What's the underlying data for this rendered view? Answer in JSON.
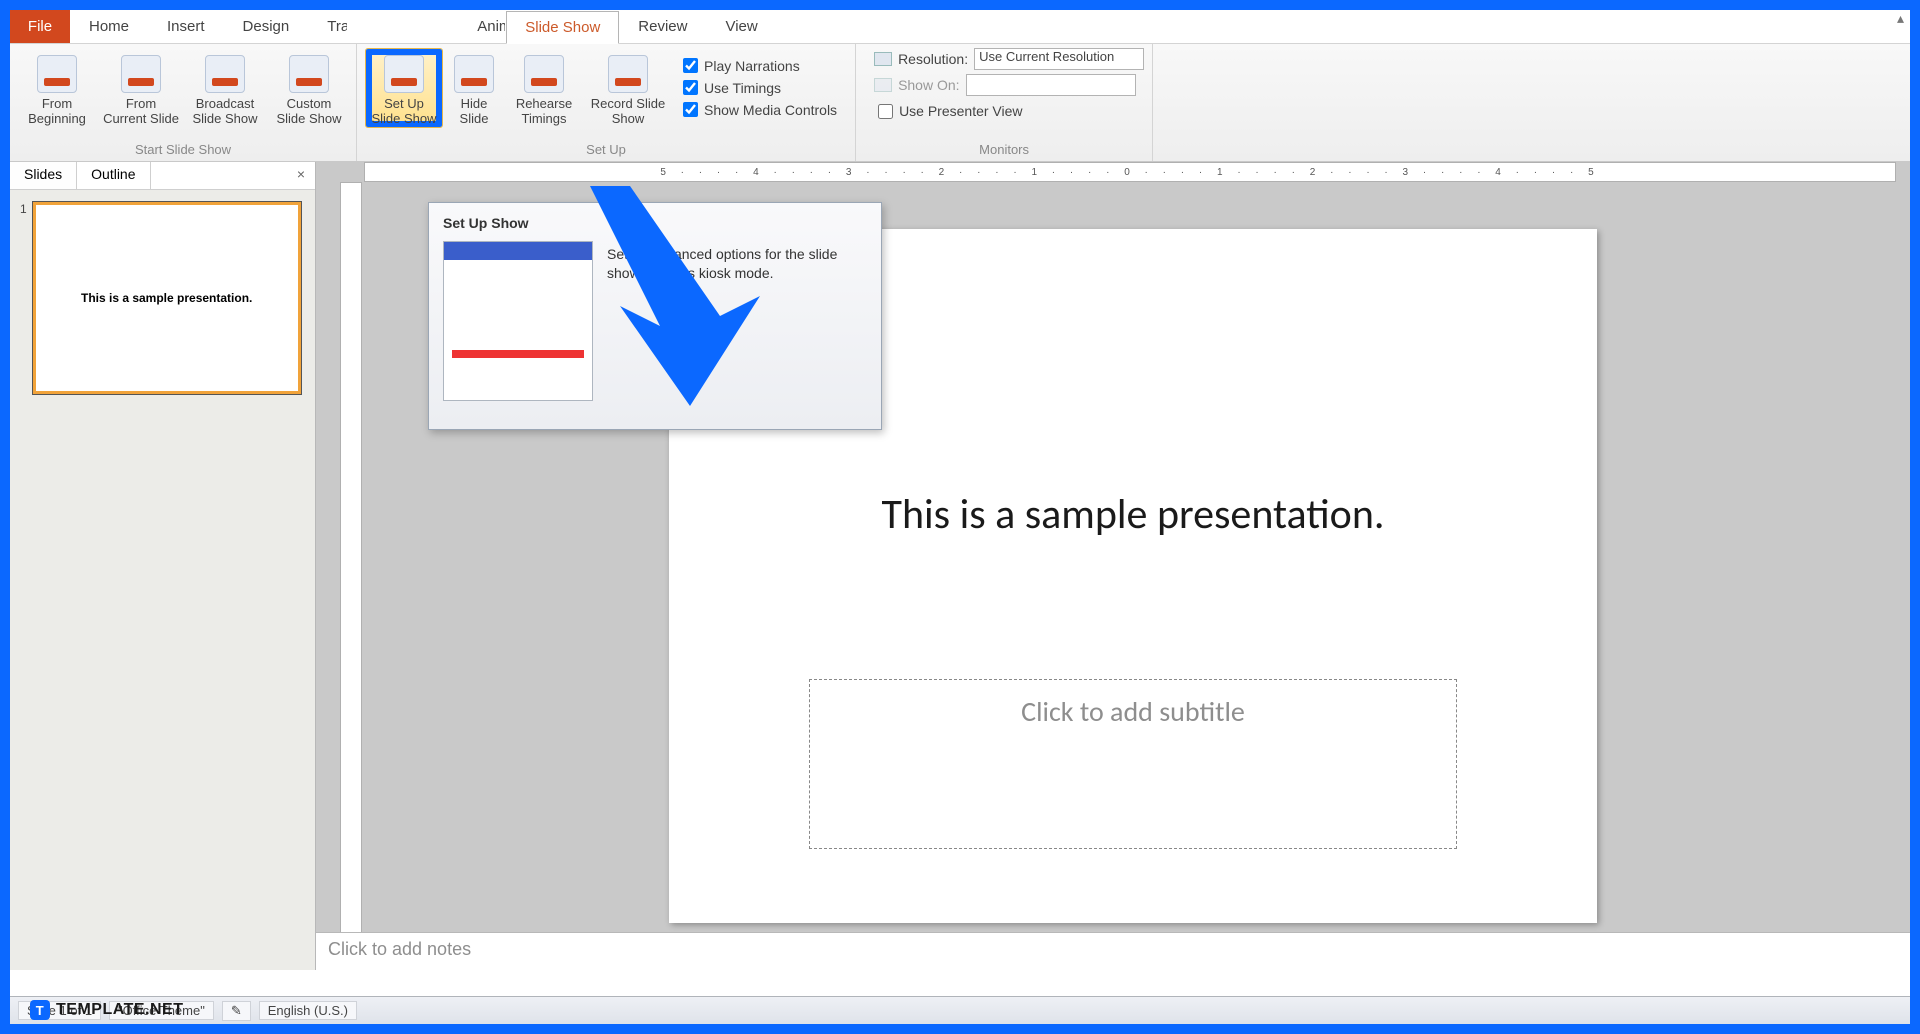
{
  "tabs": {
    "file": "File",
    "home": "Home",
    "insert": "Insert",
    "design": "Design",
    "transitions": "Transitions",
    "animations": "Animations",
    "slideShow": "Slide Show",
    "review": "Review",
    "view": "View"
  },
  "ribbon": {
    "start": {
      "fromBeginning": "From\nBeginning",
      "fromCurrent": "From\nCurrent Slide",
      "broadcast": "Broadcast\nSlide Show",
      "custom": "Custom\nSlide Show",
      "label": "Start Slide Show"
    },
    "setup": {
      "setUp": "Set Up\nSlide Show",
      "hide": "Hide\nSlide",
      "rehearse": "Rehearse\nTimings",
      "record": "Record Slide\nShow",
      "playNarrations": "Play Narrations",
      "useTimings": "Use Timings",
      "showMedia": "Show Media Controls",
      "label": "Set Up"
    },
    "monitors": {
      "resolutionLabel": "Resolution:",
      "resolutionValue": "Use Current Resolution",
      "showOnLabel": "Show On:",
      "usePresenter": "Use Presenter View",
      "label": "Monitors"
    }
  },
  "tooltip": {
    "title": "Set Up Show",
    "desc": "Set up advanced options for the slide show, such as kiosk mode."
  },
  "pane": {
    "slidesTab": "Slides",
    "outlineTab": "Outline",
    "close": "×",
    "thumbNumber": "1",
    "thumbText": "This is a sample presentation."
  },
  "slide": {
    "title": "This is a sample presentation.",
    "subtitlePlaceholder": "Click to add subtitle"
  },
  "notes": {
    "placeholder": "Click to add notes"
  },
  "ruler": {
    "ticks": "5 · · · · 4 · · · · 3 · · · · 2 · · · · 1 · · · · 0 · · · · 1 · · · · 2 · · · · 3 · · · · 4 · · · · 5"
  },
  "status": {
    "slideInfo": "Slide 1 of 1",
    "theme": "\"Office Theme\"",
    "language": "English (U.S.)"
  },
  "watermark": {
    "text": "TEMPLATE.NET",
    "logo": "T"
  },
  "checked": {
    "narrations": true,
    "timings": true,
    "media": true,
    "presenter": false
  }
}
